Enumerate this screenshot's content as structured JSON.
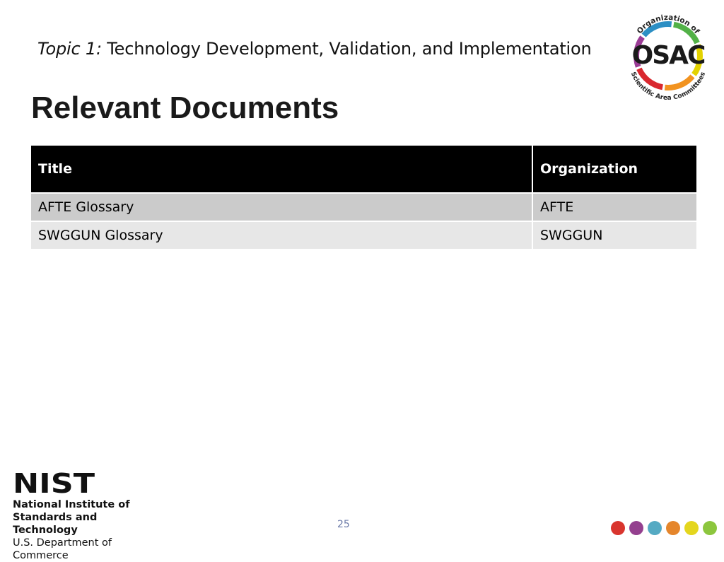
{
  "header": {
    "topic_prefix": "Topic 1:",
    "topic_text": " Technology Development, Validation, and Implementation"
  },
  "page_title": "Relevant Documents",
  "logo": {
    "arc_top": "Organization of",
    "main": "OSAC",
    "arc_bottom": "Scientific Area Committees",
    "ring_colors": [
      "#9b3c96",
      "#2c8fc4",
      "#52b147",
      "#e3d200",
      "#f29320",
      "#d9282f"
    ]
  },
  "table": {
    "columns": [
      "Title",
      "Organization"
    ],
    "rows": [
      [
        "AFTE Glossary",
        "AFTE"
      ],
      [
        "SWGGUN Glossary",
        "SWGGUN"
      ]
    ]
  },
  "footer": {
    "nist_mark": "NIST",
    "nist_line1": "National Institute of",
    "nist_line2": "Standards and Technology",
    "nist_line3": "U.S. Department of Commerce",
    "page_number": "25",
    "dot_colors": [
      "#d9352e",
      "#94408f",
      "#55aac3",
      "#e5862c",
      "#e4d61e",
      "#8cc63e"
    ]
  }
}
